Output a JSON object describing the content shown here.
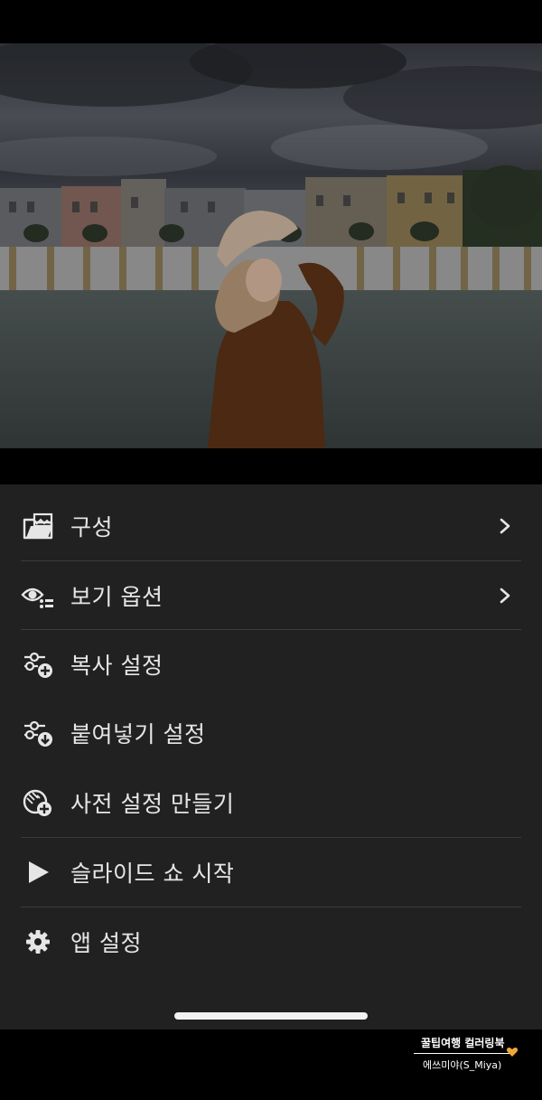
{
  "menu": {
    "items": [
      {
        "label": "구성",
        "icon": "folder-image-icon",
        "has_chevron": true
      },
      {
        "label": "보기 옵션",
        "icon": "eye-list-icon",
        "has_chevron": true
      },
      {
        "label": "복사 설정",
        "icon": "copy-settings-icon",
        "has_chevron": false
      },
      {
        "label": "붙여넣기 설정",
        "icon": "paste-settings-icon",
        "has_chevron": false
      },
      {
        "label": "사전 설정 만들기",
        "icon": "create-preset-icon",
        "has_chevron": false
      },
      {
        "label": "슬라이드 쇼 시작",
        "icon": "play-icon",
        "has_chevron": false
      },
      {
        "label": "앱 설정",
        "icon": "gear-icon",
        "has_chevron": false
      }
    ]
  },
  "watermark": {
    "line1": "꿀팁여행 컬러링북",
    "line2": "에쓰미야(S_Miya)"
  },
  "colors": {
    "sheet_bg": "#212121",
    "label": "#e6e6e6",
    "heart": "#f0a63a"
  }
}
